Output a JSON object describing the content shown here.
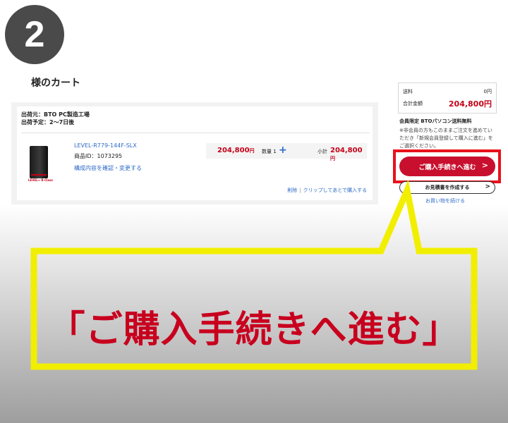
{
  "step": {
    "number": "2"
  },
  "cart": {
    "title": "様のカート",
    "ship_from": "出荷元：BTO PC製造工場",
    "ship_date": "出荷予定：2～7日後",
    "item": {
      "name": "LEVEL-R779-144F-SLX",
      "product_id": "商品ID：1073295",
      "config_link": "構成内容を確認・変更する",
      "brand": "LEVEL∞ R-Class",
      "price": "204,800",
      "yen": "円",
      "qty_label": "数量 1",
      "subtotal_label": "小計",
      "subtotal": "204,800",
      "delete": "削除",
      "separator": "|",
      "clip": "クリップしてあとで購入する"
    }
  },
  "summary": {
    "shipping_label": "送料",
    "shipping_value": "0円",
    "total_label": "合計金額",
    "total_value": "204,800円",
    "notice_title": "会員限定 BTOパソコン送料無料",
    "notice_text": "※非会員の方もこのままご注文を進めていただき「新規会員登録して購入に進む」をご選択ください。"
  },
  "actions": {
    "checkout": "ご購入手続きへ進む",
    "checkout_chevron": ">",
    "quote": "お見積書を作成する",
    "quote_chevron": ">",
    "continue": "お買い物を続ける"
  },
  "callout": {
    "text": "「ご購入手続きへ進む」"
  },
  "colors": {
    "accent_red": "#c8102e",
    "highlight_red": "#e8111b",
    "callout_yellow": "#f2ee00",
    "link_blue": "#2d6ac7",
    "badge_gray": "#4a4a4a"
  }
}
